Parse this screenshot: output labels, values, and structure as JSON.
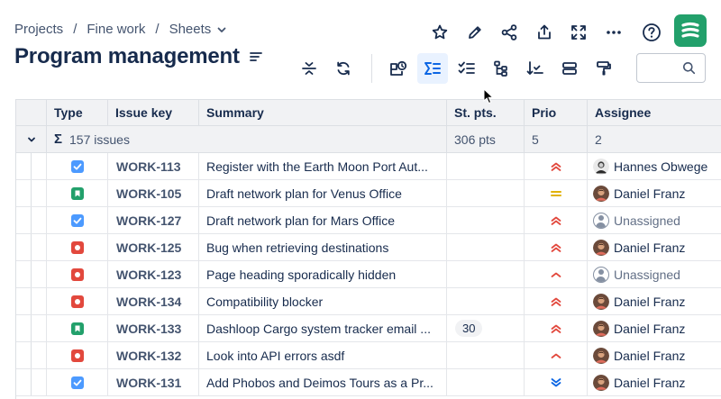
{
  "breadcrumb": {
    "items": [
      "Projects",
      "Fine work",
      "Sheets"
    ],
    "separator": "/"
  },
  "page": {
    "title": "Program management"
  },
  "top_actions": [
    "star-icon",
    "pencil-icon",
    "share-icon",
    "export-icon",
    "fullscreen-icon",
    "more-icon"
  ],
  "toolbar": {
    "buttons": [
      "collapse-icon",
      "refresh-icon",
      "add-view-icon",
      "sum-icon",
      "checklist-icon",
      "hierarchy-icon",
      "sort-icon",
      "group-icon",
      "format-paint-icon"
    ],
    "active": "sum-icon"
  },
  "search": {
    "value": "",
    "placeholder": ""
  },
  "colors": {
    "accent": "#0c66e4",
    "brand": "#22a06b",
    "task": "#4c9aff",
    "story": "#22a06b",
    "bug": "#e2483d",
    "prio_high": "#e2483d",
    "prio_medium": "#e2b203",
    "prio_low": "#0c66e4"
  },
  "table": {
    "columns": {
      "type": "Type",
      "key": "Issue key",
      "summary": "Summary",
      "points": "St. pts.",
      "prio": "Prio",
      "assignee": "Assignee"
    },
    "group": {
      "sigma": "Σ",
      "count": "157 issues",
      "points": "306 pts",
      "prio": "5",
      "assignee": "2"
    },
    "rows": [
      {
        "type": "task",
        "key": "WORK-113",
        "summary": "Register with the Earth Moon Port Aut...",
        "points": "",
        "prio": "highest",
        "assignee": "Hannes Obwege",
        "avatar": "hannes"
      },
      {
        "type": "story",
        "key": "WORK-105",
        "summary": "Draft network plan for Venus Office",
        "points": "",
        "prio": "medium",
        "assignee": "Daniel Franz",
        "avatar": "daniel"
      },
      {
        "type": "task",
        "key": "WORK-127",
        "summary": "Draft network plan for Mars Office",
        "points": "",
        "prio": "highest",
        "assignee": "Unassigned",
        "avatar": "unassigned"
      },
      {
        "type": "bug",
        "key": "WORK-125",
        "summary": "Bug when retrieving destinations",
        "points": "",
        "prio": "highest",
        "assignee": "Daniel Franz",
        "avatar": "daniel"
      },
      {
        "type": "bug",
        "key": "WORK-123",
        "summary": "Page heading sporadically hidden",
        "points": "",
        "prio": "high",
        "assignee": "Unassigned",
        "avatar": "unassigned"
      },
      {
        "type": "bug",
        "key": "WORK-134",
        "summary": "Compatibility blocker",
        "points": "",
        "prio": "highest",
        "assignee": "Daniel Franz",
        "avatar": "daniel"
      },
      {
        "type": "story",
        "key": "WORK-133",
        "summary": "Dashloop Cargo system tracker email ...",
        "points": "30",
        "prio": "highest",
        "assignee": "Daniel Franz",
        "avatar": "daniel"
      },
      {
        "type": "bug",
        "key": "WORK-132",
        "summary": "Look into API errors asdf",
        "points": "",
        "prio": "high",
        "assignee": "Daniel Franz",
        "avatar": "daniel"
      },
      {
        "type": "task",
        "key": "WORK-131",
        "summary": "Add Phobos and Deimos Tours as a Pr...",
        "points": "",
        "prio": "lowest",
        "assignee": "Daniel Franz",
        "avatar": "daniel"
      }
    ]
  }
}
